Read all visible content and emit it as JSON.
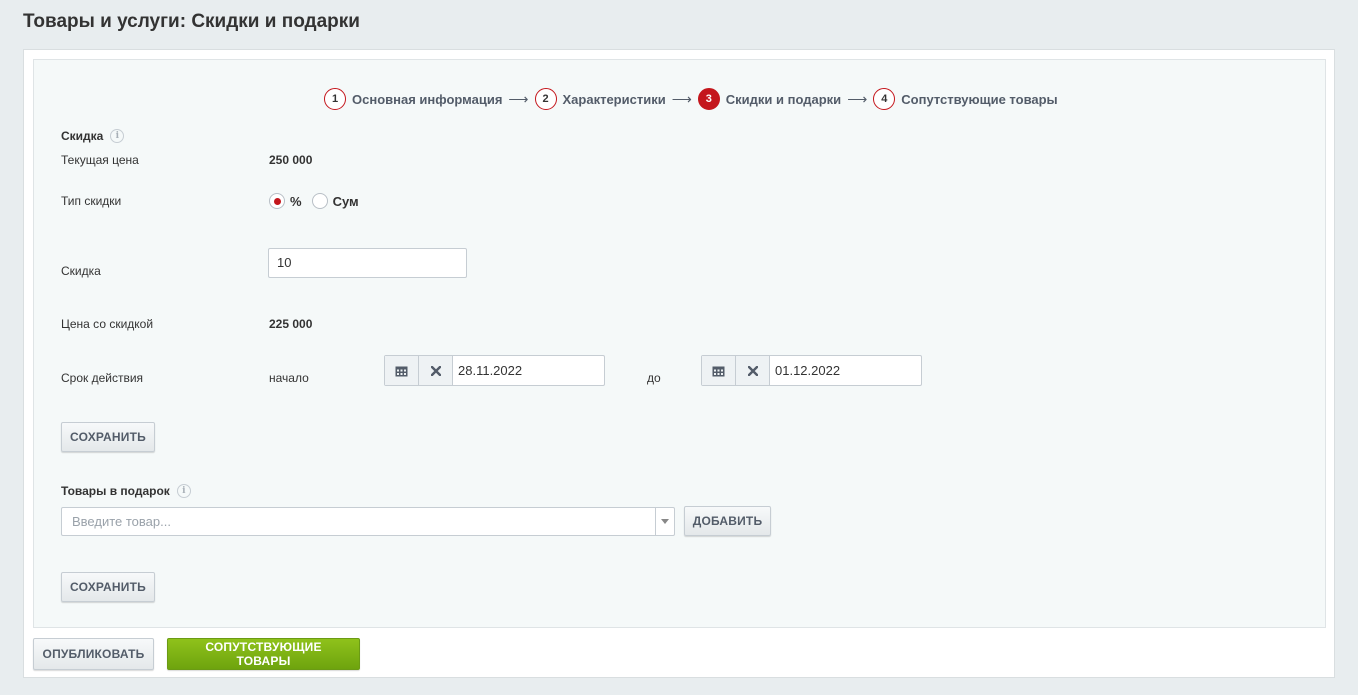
{
  "page": {
    "title": "Товары и услуги: Скидки и подарки"
  },
  "stepper": {
    "steps": [
      {
        "number": "1",
        "label": "Основная информация",
        "active": false
      },
      {
        "number": "2",
        "label": "Характеристики",
        "active": false
      },
      {
        "number": "3",
        "label": "Скидки и подарки",
        "active": true
      },
      {
        "number": "4",
        "label": "Сопутствующие товары",
        "active": false
      }
    ],
    "arrow": "⟶"
  },
  "discount": {
    "section_title": "Скидка",
    "current_price_label": "Текущая цена",
    "current_price_value": "250 000",
    "type_label": "Тип скидки",
    "type_options": [
      {
        "label": "%",
        "selected": true
      },
      {
        "label": "Сум",
        "selected": false
      }
    ],
    "discount_label": "Скидка",
    "discount_value": "10",
    "discounted_price_label": "Цена со скидкой",
    "discounted_price_value": "225 000",
    "period_label": "Срок действия",
    "start_label": "начало",
    "start_date": "28.11.2022",
    "end_label": "до",
    "end_date": "01.12.2022",
    "save_label": "СОХРАНИТЬ"
  },
  "gifts": {
    "section_title": "Товары в подарок",
    "input_placeholder": "Введите товар...",
    "add_label": "ДОБАВИТЬ",
    "save_label": "СОХРАНИТЬ"
  },
  "footer": {
    "publish_label": "ОПУБЛИКОВАТЬ",
    "next_label": "СОПУТСТВУЮЩИЕ ТОВАРЫ"
  },
  "info_icon_glyph": "i",
  "colors": {
    "accent_red": "#c4161c",
    "green_button": "#7db214",
    "page_bg": "#e8edef",
    "panel_bg": "#f5f9f9"
  }
}
